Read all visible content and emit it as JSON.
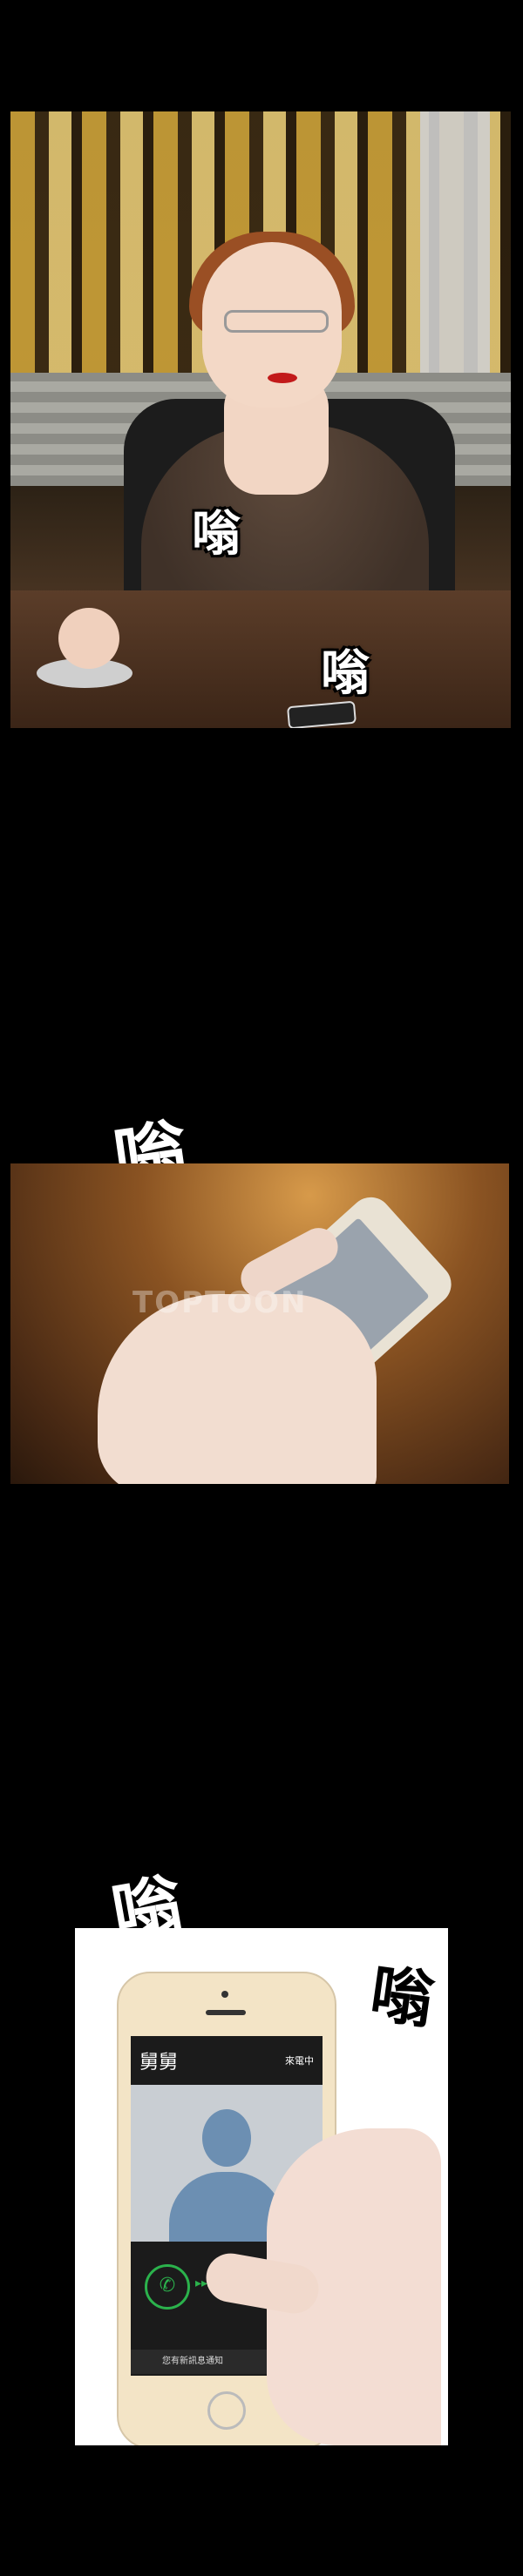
{
  "panels": {
    "office": {
      "sfx_1": "嗡",
      "sfx_2": "嗡"
    },
    "phone_touch": {
      "sfx": "嗡",
      "watermark": "TOPTOON"
    },
    "incoming_call": {
      "sfx_left": "嗡",
      "sfx_right": "嗡",
      "caller_name": "舅舅",
      "call_status": "來電中",
      "message_bar": "您有新訊息通知",
      "answer_icon": "phone-answer-icon",
      "decline_icon": "phone-decline-icon",
      "answer_arrows": "▸▸▸",
      "decline_arrows": "◂◂◂",
      "colors": {
        "answer": "#2bb24c",
        "decline": "#d9282f"
      }
    }
  }
}
